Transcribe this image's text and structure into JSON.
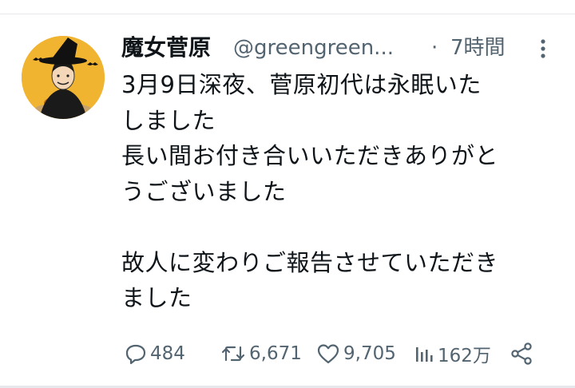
{
  "tweet": {
    "display_name": "魔女菅原",
    "handle": "@greengreen...",
    "separator": "·",
    "time": "7時間",
    "body": "3月9日深夜、菅原初代は永眠いた\nしました\n長い間お付き合いいただきありがと\nうございました\n\n故人に変わりご報告させていただき\nました",
    "actions": {
      "reply_count": "484",
      "retweet_count": "6,671",
      "like_count": "9,705",
      "view_count": "162万"
    }
  },
  "icons": {
    "avatar": "witch-illustration-avatar",
    "more": "more-vertical-icon",
    "reply": "reply-bubble-icon",
    "retweet": "retweet-icon",
    "like": "heart-icon",
    "views": "views-bar-chart-icon",
    "share": "share-icon"
  },
  "colors": {
    "text": "#0f1419",
    "secondary": "#536471",
    "avatar_bg": "#f0b431",
    "divider": "#e6e8eb"
  }
}
